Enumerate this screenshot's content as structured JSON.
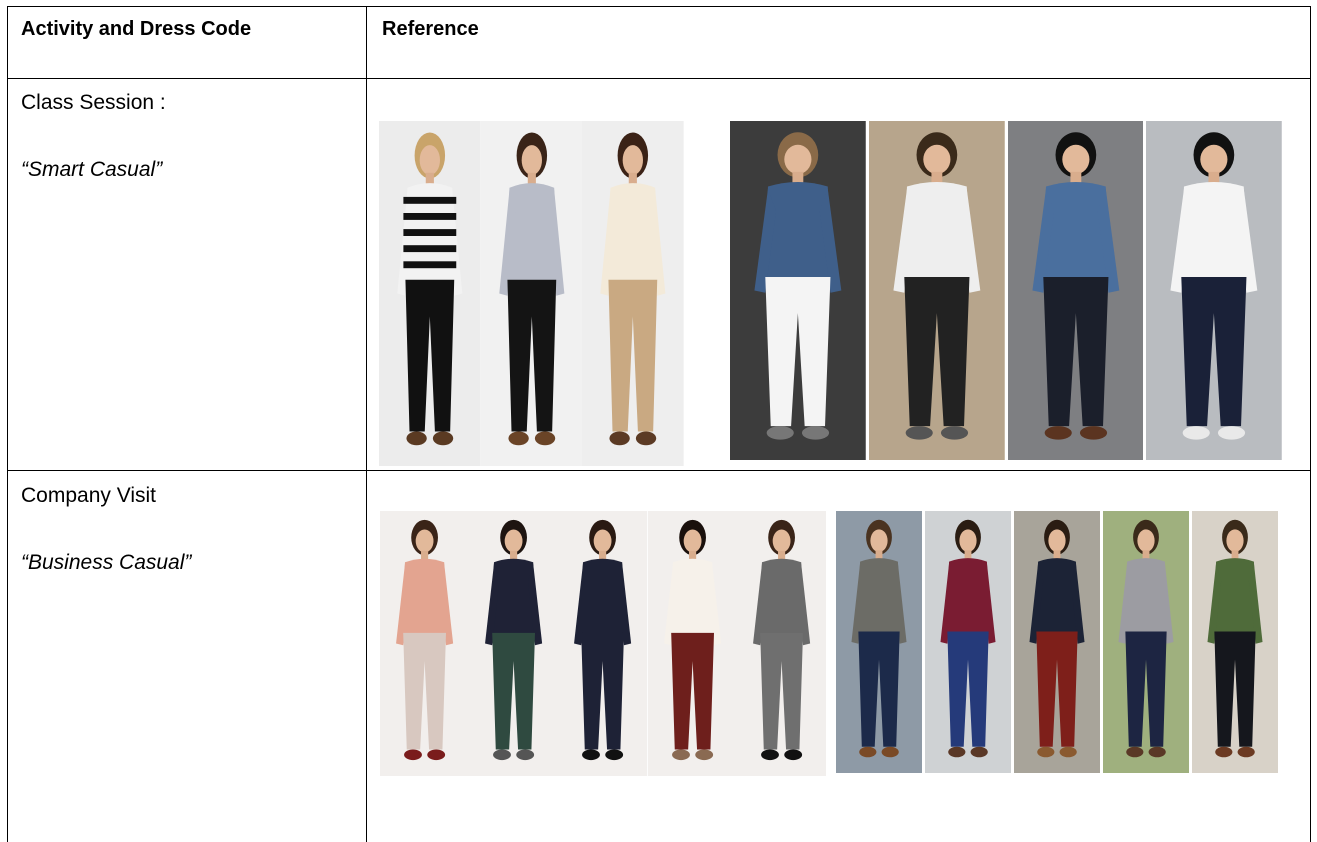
{
  "headers": {
    "activity": "Activity and Dress Code",
    "reference": "Reference"
  },
  "rows": [
    {
      "activity": "Class Session :",
      "dress_code": "“Smart Casual”",
      "women": [
        {
          "name": "striped-top-woman",
          "top": "#f2f2f2",
          "pants": "#111111",
          "shoes": "#5a3a22",
          "bg": "#ececec",
          "hair": "#c9a46a",
          "stripes": true
        },
        {
          "name": "plaid-shirt-woman",
          "top": "#b8bcc8",
          "pants": "#141414",
          "shoes": "#6a4427",
          "bg": "#f1f1f1",
          "hair": "#3a2418"
        },
        {
          "name": "blouse-khaki-woman",
          "top": "#f3ead9",
          "pants": "#c9a982",
          "shoes": "#5b3a24",
          "bg": "#eeeeee",
          "hair": "#3b2216"
        }
      ],
      "men": [
        {
          "name": "denim-shirt-man",
          "top": "#3f5f8a",
          "pants": "#f4f4f4",
          "shoes": "#777777",
          "bg": "#3c3c3c",
          "hair": "#8a6a48"
        },
        {
          "name": "white-shirt-man",
          "top": "#eeeeee",
          "pants": "#222222",
          "shoes": "#555555",
          "bg": "#b7a58c",
          "hair": "#3a2a1a"
        },
        {
          "name": "denim-beanie-man",
          "top": "#4a6f9e",
          "pants": "#1b1f2b",
          "shoes": "#5b3420",
          "bg": "#7e7f82",
          "hair": "#111111"
        },
        {
          "name": "white-shirt-hat-man",
          "top": "#f4f4f4",
          "pants": "#1a2138",
          "shoes": "#e9e9e9",
          "bg": "#b9bcc0",
          "hair": "#111111"
        }
      ]
    },
    {
      "activity": "Company Visit",
      "dress_code": "“Business Casual”",
      "women": [
        {
          "name": "pink-sweater-woman",
          "top": "#e3a490",
          "pants": "#d8c8c0",
          "shoes": "#7a1c1c",
          "bg": "#f2efed",
          "hair": "#3a2418"
        },
        {
          "name": "navy-leather-skirt-woman",
          "top": "#1f2236",
          "pants": "#2f4a40",
          "shoes": "#555555",
          "bg": "#f2efed",
          "hair": "#1e1410"
        },
        {
          "name": "navy-dress-woman",
          "top": "#1e2236",
          "pants": "#1e2236",
          "shoes": "#111111",
          "bg": "#f2efed",
          "hair": "#2a1a12"
        },
        {
          "name": "burgundy-trousers-woman",
          "top": "#f6f1ea",
          "pants": "#6e1f1c",
          "shoes": "#8a6a52",
          "bg": "#f2efed",
          "hair": "#1a100c"
        },
        {
          "name": "grey-suit-woman",
          "top": "#6a6a6a",
          "pants": "#6f6f6f",
          "shoes": "#111111",
          "bg": "#f2efed",
          "hair": "#3a2418"
        }
      ],
      "men": [
        {
          "name": "grey-blazer-man",
          "top": "#6c6c66",
          "pants": "#1c2a4a",
          "shoes": "#7a4a26",
          "bg": "#8e9aa6",
          "hair": "#4a3320"
        },
        {
          "name": "burgundy-sweater-man",
          "top": "#7a1c32",
          "pants": "#253a7a",
          "shoes": "#5a3826",
          "bg": "#cfd2d4",
          "hair": "#2a1c12"
        },
        {
          "name": "navy-coat-man",
          "top": "#1c2336",
          "pants": "#7e1f1a",
          "shoes": "#8a5a30",
          "bg": "#a8a49a",
          "hair": "#2a1c12"
        },
        {
          "name": "grey-sweater-man",
          "top": "#9c9ca2",
          "pants": "#1d2542",
          "shoes": "#5a3826",
          "bg": "#9fb07e",
          "hair": "#3a2a1a"
        },
        {
          "name": "green-sweater-man",
          "top": "#4f6b3a",
          "pants": "#15171d",
          "shoes": "#6b3a22",
          "bg": "#d8d2c8",
          "hair": "#3a2a1a"
        }
      ]
    }
  ]
}
